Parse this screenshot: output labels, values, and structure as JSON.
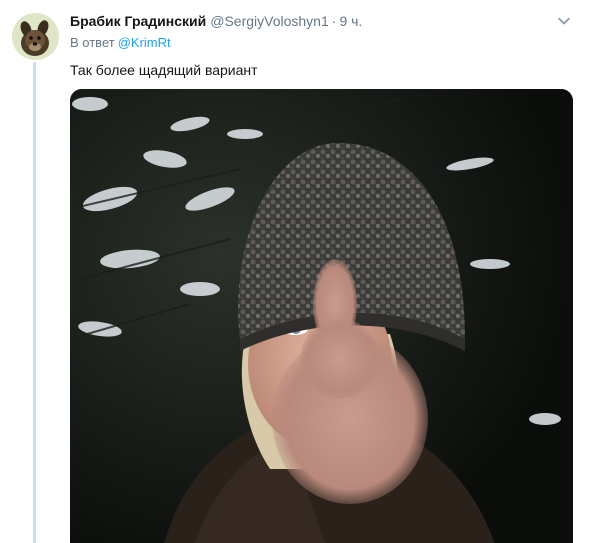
{
  "tweet": {
    "author_name": "Брабик Градинский",
    "handle": "@SergiyVoloshyn1",
    "separator": "·",
    "time": "9 ч.",
    "reply_prefix": "В ответ",
    "reply_mention": "@KrimRt",
    "text": "Так более щадящий вариант",
    "caret_icon": "chevron-down-icon",
    "avatar_icon": "dog-avatar",
    "photo": "selfie-in-fur-hat-snowy-forest-night"
  },
  "colors": {
    "thread_line": "#c4e0f2",
    "link": "#1da1f2",
    "meta": "#657786",
    "text": "#14171a"
  }
}
